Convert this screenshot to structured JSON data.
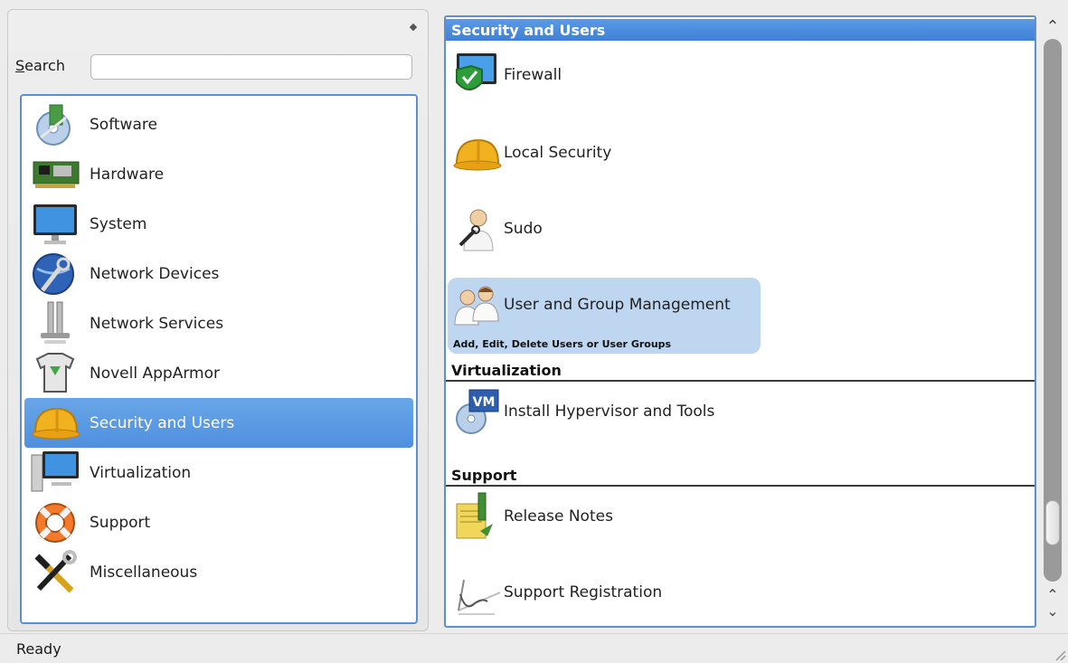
{
  "search": {
    "label": "Search",
    "mnemonic": "S",
    "rest": "earch",
    "value": ""
  },
  "categories": [
    {
      "label": "Software",
      "icon": "software-icon"
    },
    {
      "label": "Hardware",
      "icon": "hardware-icon"
    },
    {
      "label": "System",
      "icon": "system-icon"
    },
    {
      "label": "Network Devices",
      "icon": "network-devices-icon"
    },
    {
      "label": "Network Services",
      "icon": "network-services-icon"
    },
    {
      "label": "Novell AppArmor",
      "icon": "apparmor-icon"
    },
    {
      "label": "Security and Users",
      "icon": "security-helmet-icon",
      "selected": true
    },
    {
      "label": "Virtualization",
      "icon": "virtualization-icon"
    },
    {
      "label": "Support",
      "icon": "support-lifebuoy-icon"
    },
    {
      "label": "Miscellaneous",
      "icon": "miscellaneous-tools-icon"
    }
  ],
  "sections": [
    {
      "title": "Security and Users",
      "modules": [
        {
          "label": "Firewall",
          "icon": "firewall-icon"
        },
        {
          "label": "Local Security",
          "icon": "local-security-icon"
        },
        {
          "label": "Sudo",
          "icon": "sudo-icon"
        },
        {
          "label": "User and Group Management",
          "icon": "user-group-icon",
          "selected": true,
          "description": "Add, Edit, Delete Users or User Groups"
        }
      ]
    },
    {
      "title": "Virtualization",
      "modules": [
        {
          "label": "Install Hypervisor and Tools",
          "icon": "hypervisor-vm-icon"
        }
      ]
    },
    {
      "title": "Support",
      "modules": [
        {
          "label": "Release Notes",
          "icon": "release-notes-icon"
        },
        {
          "label": "Support Registration",
          "icon": "support-registration-icon"
        }
      ]
    }
  ],
  "scrollbar": {
    "position": 0.93
  },
  "status": {
    "text": "Ready"
  },
  "colors": {
    "accent": "#4f8fde",
    "selection_light": "#bfd6f1",
    "list_border": "#5d8fd0"
  }
}
